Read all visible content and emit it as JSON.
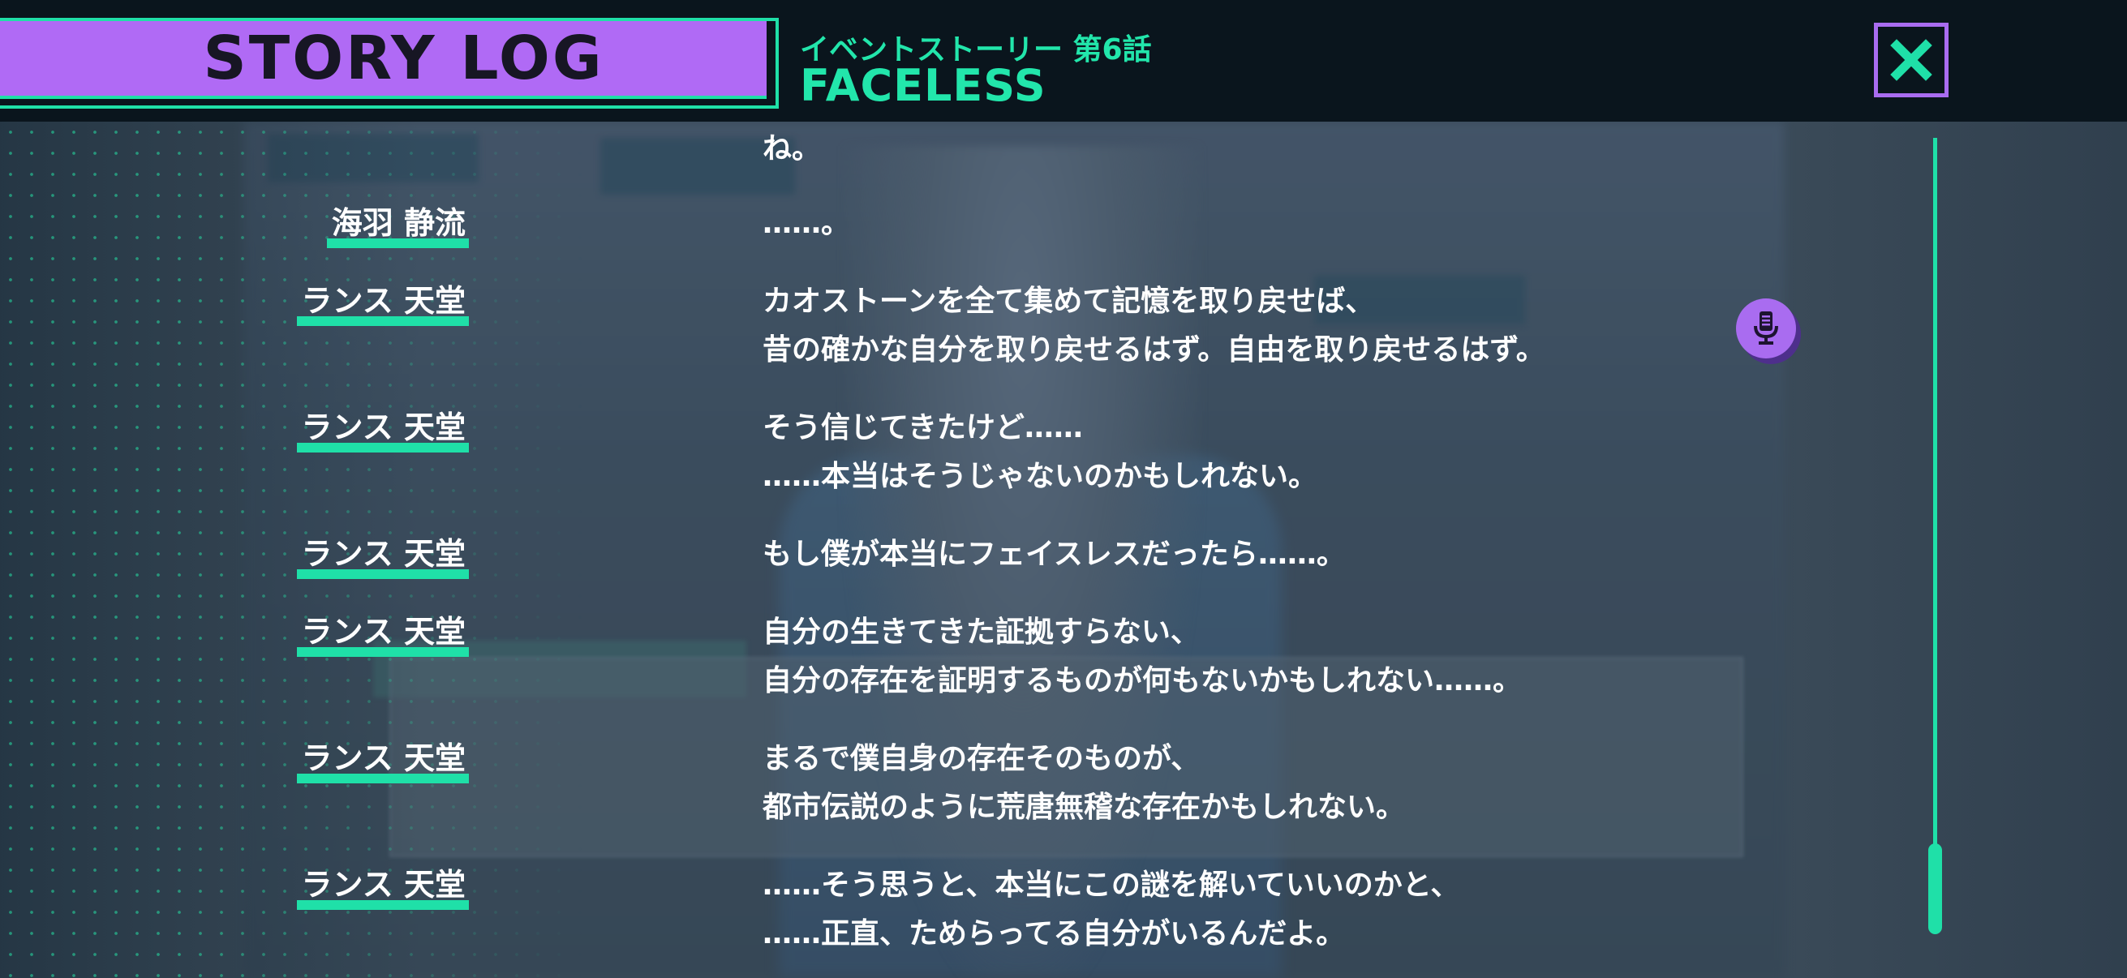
{
  "header": {
    "title": "STORY LOG",
    "episode_label": "イベントストーリー 第6話",
    "episode_title": "FACELESS",
    "close_icon": "close-icon"
  },
  "colors": {
    "accent_green": "#1fe0a8",
    "accent_purple": "#b06af5",
    "header_bg": "#0a151d"
  },
  "log": {
    "entries": [
      {
        "speaker": "",
        "lines": [
          "ね。"
        ]
      },
      {
        "speaker": "海羽 静流",
        "lines": [
          "……。"
        ]
      },
      {
        "speaker": "ランス 天堂",
        "lines": [
          "カオストーンを全て集めて記憶を取り戻せば、",
          "昔の確かな自分を取り戻せるはず。自由を取り戻せるはず。"
        ],
        "voice_icon": "microphone-icon"
      },
      {
        "speaker": "ランス 天堂",
        "lines": [
          "そう信じてきたけど……",
          "……本当はそうじゃないのかもしれない。"
        ]
      },
      {
        "speaker": "ランス 天堂",
        "lines": [
          "もし僕が本当にフェイスレスだったら……。"
        ]
      },
      {
        "speaker": "ランス 天堂",
        "lines": [
          "自分の生きてきた証拠すらない、",
          "自分の存在を証明するものが何もないかもしれない……。"
        ]
      },
      {
        "speaker": "ランス 天堂",
        "lines": [
          "まるで僕自身の存在そのものが、",
          "都市伝説のように荒唐無稽な存在かもしれない。"
        ]
      },
      {
        "speaker": "ランス 天堂",
        "lines": [
          "……そう思うと、本当にこの謎を解いていいのかと、",
          "……正直、ためらってる自分がいるんだよ。"
        ]
      }
    ]
  },
  "scrollbar": {
    "position_fraction": 1.0
  }
}
